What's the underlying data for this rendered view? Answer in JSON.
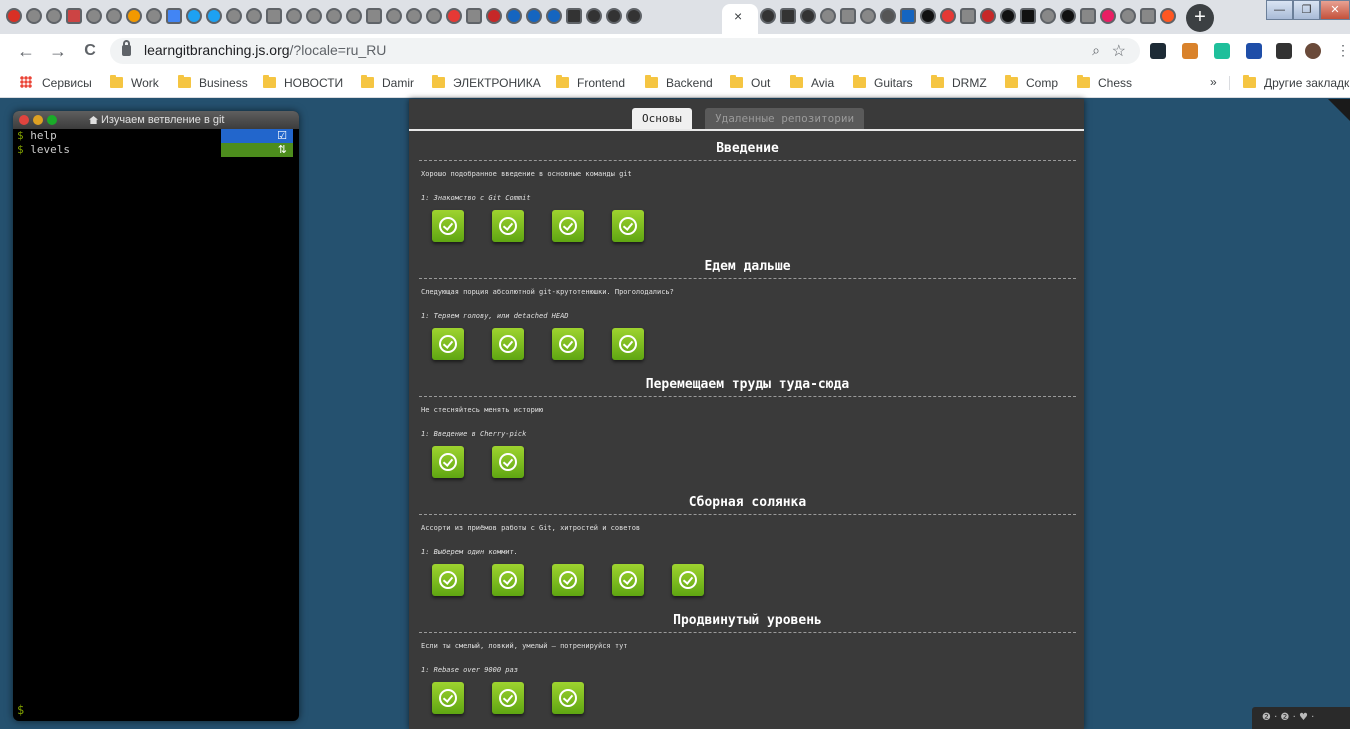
{
  "browser": {
    "tab_close": "×",
    "new_tab": "+",
    "window_controls": [
      "—",
      "❐",
      "✕"
    ],
    "nav": {
      "back": "←",
      "forward": "→",
      "reload": "C"
    },
    "url_host": "learngitbranching.js.org",
    "url_rest": "/?locale=ru_RU",
    "omnibox_icons": [
      "zoom-icon",
      "star-icon"
    ]
  },
  "bookmarks": {
    "items": [
      "Сервисы",
      "Work",
      "Business",
      "НОВОСТИ",
      "Damir",
      "ЭЛЕКТРОНИКА",
      "Frontend",
      "Backend",
      "Out",
      "Avia",
      "Guitars",
      "DRMZ",
      "Comp",
      "Chess"
    ],
    "more": "»",
    "other": "Другие закладки"
  },
  "terminal": {
    "title": "Изучаем ветвление в git",
    "lines": [
      {
        "prompt": "$",
        "cmd": "help",
        "status_glyph": "☑",
        "status_color": "#2266cc"
      },
      {
        "prompt": "$",
        "cmd": "levels",
        "status_glyph": "⇅",
        "status_color": "#4d8d1d"
      }
    ],
    "bottom_prompt": "$"
  },
  "panel": {
    "tabs": [
      "Основы",
      "Удаленные репозитории"
    ],
    "sections": [
      {
        "title": "Введение",
        "desc": "Хорошо подобранное введение в основные команды git",
        "level": "1: Знакомство с Git Commit",
        "completed": 4
      },
      {
        "title": "Едем дальше",
        "desc": "Следующая порция абсолютной git-крутотенюшки. Проголодались?",
        "level": "1: Теряем голову, или detached HEAD",
        "completed": 4
      },
      {
        "title": "Перемещаем труды туда-сюда",
        "desc": "Не стесняйтесь менять историю",
        "level": "1: Введение в Cherry-pick",
        "completed": 2
      },
      {
        "title": "Сборная солянка",
        "desc": "Ассорти из приёмов работы с Git, хитростей и советов",
        "level": "1: Выберем один коммит.",
        "completed": 5
      },
      {
        "title": "Продвинутый уровень",
        "desc": "Если ты смелый, ловкий, умелый – потренируйся тут",
        "level": "1: Rebase over 9000 раз",
        "completed": 3
      }
    ]
  },
  "footer_widget": "❷ · ❷ · ♥ ·",
  "colors": {
    "page_bg": "#25516f",
    "panel_bg": "#3a3a3a",
    "level_complete": "#7cc11f"
  }
}
